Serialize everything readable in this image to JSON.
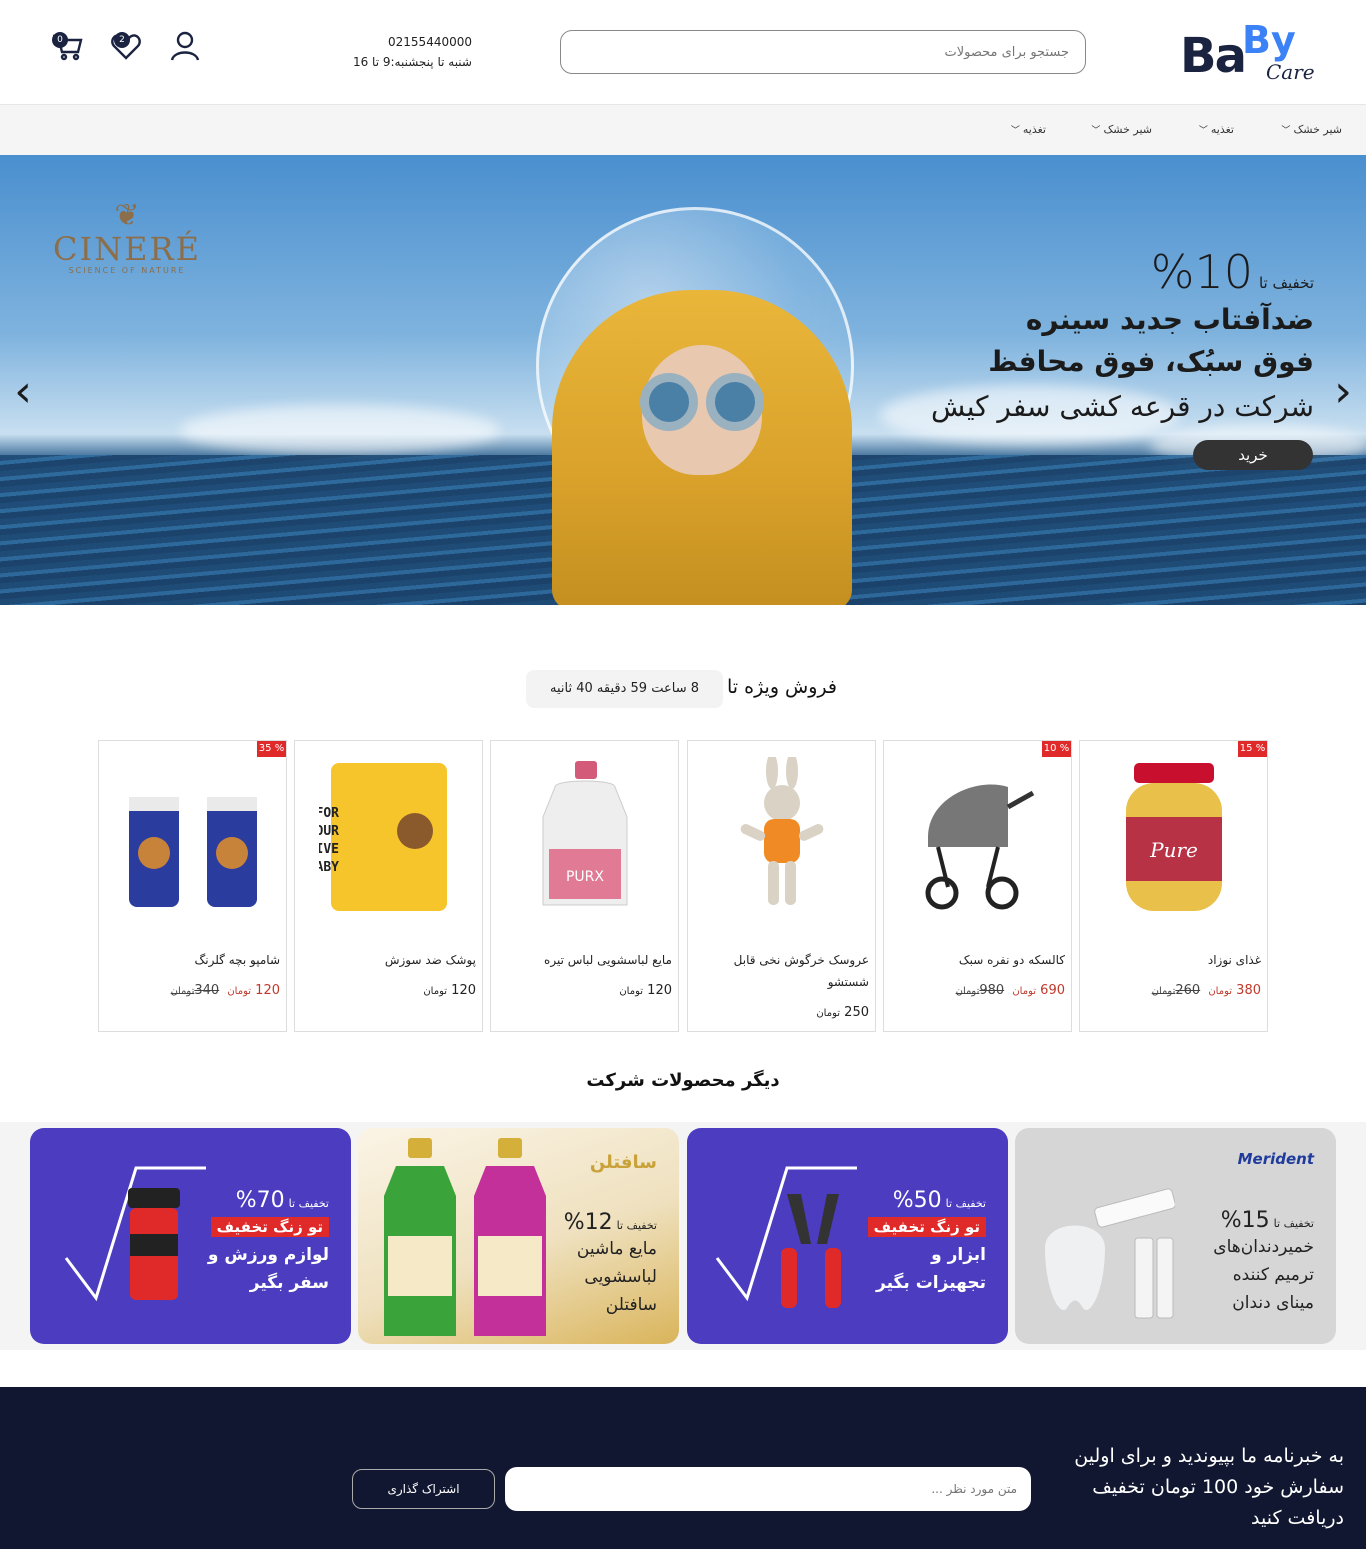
{
  "header": {
    "logo": {
      "ba": "Ba",
      "by": "By",
      "care": "Care"
    },
    "search_placeholder": "جستجو برای محصولات",
    "phone": "02155440000",
    "hours": "شنبه تا پنجشنبه:9 تا 16",
    "cart_count": "0",
    "wishlist_count": "2"
  },
  "nav": {
    "items": [
      {
        "label": "شیر خشک"
      },
      {
        "label": "تغذیه"
      },
      {
        "label": "شیر خشک"
      },
      {
        "label": "تغذیه"
      }
    ]
  },
  "hero": {
    "brand_name": "CINERÉ",
    "brand_tagline": "SCIENCE OF NATURE",
    "discount_prefix": "تخفیف تا",
    "discount_value": "10%",
    "line1": "ضدآفتاب جدید سینره",
    "line2": "فوق سبُک، فوق محافظ",
    "line3": "شرکت در قرعه کشی سفر کیش",
    "button": "خرید",
    "prev_arrow": "‹",
    "next_arrow": "›"
  },
  "special": {
    "title": "فروش ویژه تا",
    "countdown": "8 ساعت 59 دقیقه 40 ثانیه"
  },
  "products": [
    {
      "title": "غذای نوزاد",
      "discount": "15 %",
      "price": "380",
      "old_price": "260",
      "currency": "تومان",
      "old_currency": "تومان"
    },
    {
      "title": "کالسکه دو نفره سبک",
      "discount": "10 %",
      "price": "690",
      "old_price": "980",
      "currency": "تومان",
      "old_currency": "تومان"
    },
    {
      "title": "عروسک خرگوش نخی قابل شستشو",
      "discount": "",
      "price": "250",
      "old_price": "",
      "currency": "تومان",
      "old_currency": ""
    },
    {
      "title": "مایع لباسشویی لباس تیره",
      "discount": "",
      "price": "120",
      "old_price": "",
      "currency": "تومان",
      "old_currency": ""
    },
    {
      "title": "پوشک ضد سوزش",
      "discount": "",
      "price": "120",
      "old_price": "",
      "currency": "تومان",
      "old_currency": ""
    },
    {
      "title": "شامپو بچه گلرنگ",
      "discount": "35 %",
      "price": "120",
      "old_price": "340",
      "currency": "تومان",
      "old_currency": "تومان"
    }
  ],
  "other": {
    "title": "دیگر محصولات شرکت"
  },
  "promos": [
    {
      "brand": "Merident",
      "prefix": "تخفیف تا",
      "pct": "15%",
      "tag": "",
      "lines": [
        "خمیردندان‌های",
        "ترمیم کننده",
        "مینای دندان"
      ],
      "bg": "#d3d3d3",
      "text_color": "#222"
    },
    {
      "brand": "",
      "prefix": "تخفیف تا",
      "pct": "50%",
      "tag": "تو زنگ تخفیف",
      "lines": [
        "ابزار و",
        "تجهیزات بگیر"
      ],
      "bg": "#4b3cc0",
      "text_color": "#fff"
    },
    {
      "brand": "سافتلن",
      "prefix": "تخفیف تا",
      "pct": "12%",
      "tag": "",
      "lines": [
        "مایع ماشین",
        "لباسشویی",
        "سافتلن"
      ],
      "bg": "#f2e8d0",
      "text_color": "#222"
    },
    {
      "brand": "",
      "prefix": "تخفیف تا",
      "pct": "70%",
      "tag": "تو زنگ تخفیف",
      "lines": [
        "لوازم ورزش و",
        "سفر بگیر"
      ],
      "bg": "#4b3cc0",
      "text_color": "#fff"
    }
  ],
  "newsletter": {
    "text": "به خبرنامه ما بپیوندید و برای اولین سفارش خود 100 تومان تخفیف دریافت کنید",
    "placeholder": "متن مورد نظر ...",
    "button": "اشتراک گذاری"
  },
  "colors": {
    "navy": "#111730",
    "sale_red": "#e02a2a",
    "promo_purple": "#4b3cc0"
  }
}
